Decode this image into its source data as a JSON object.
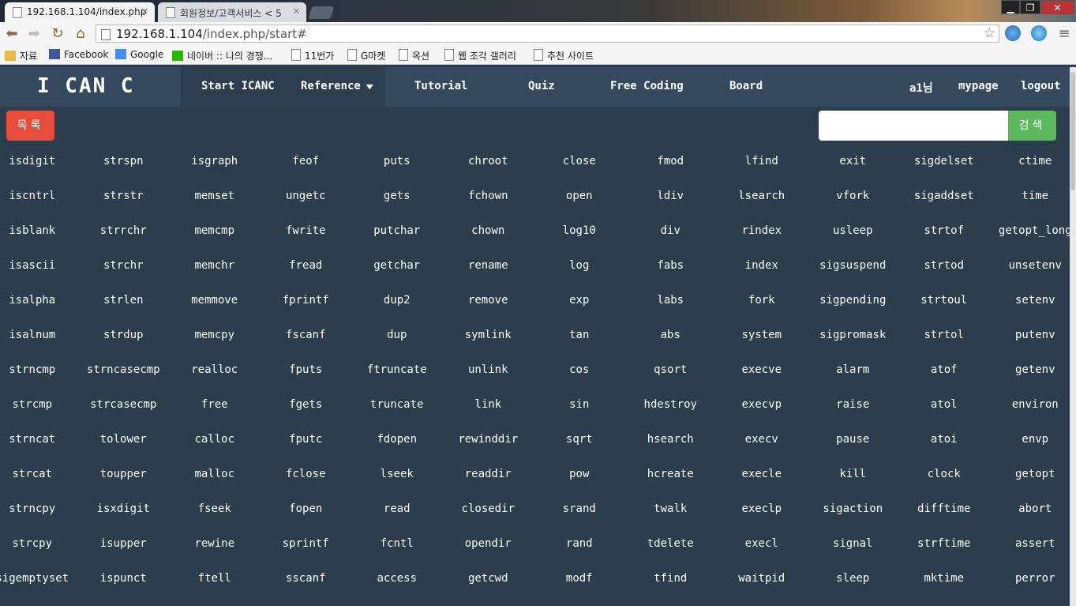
{
  "browser": {
    "tabs": [
      {
        "title": "192.168.1.104/index.php"
      },
      {
        "title": "회원정보/고객서비스 < 5"
      }
    ],
    "url_host": "192.168.1.104",
    "url_path": "/index.php/start#",
    "bookmarks": [
      "자료",
      "Facebook",
      "Google",
      "네이버 :: 나의 경쟁...",
      "11번가",
      "G마켓",
      "옥션",
      "웹 조각 갤러리",
      "추천 사이트"
    ],
    "window_buttons": {
      "min": "▁",
      "max": "❐",
      "close": "✕"
    }
  },
  "navbar": {
    "brand": "I CAN C",
    "items": {
      "start": "Start ICANC",
      "reference": "Reference",
      "tutorial": "Tutorial",
      "quiz": "Quiz",
      "free_coding": "Free Coding",
      "board": "Board",
      "user": "a1님",
      "mypage": "mypage",
      "logout": "logout"
    }
  },
  "controls": {
    "list_button": "목록",
    "search_button": "검색",
    "search_value": ""
  },
  "functions": [
    "isdigit",
    "strspn",
    "isgraph",
    "feof",
    "puts",
    "chroot",
    "close",
    "fmod",
    "lfind",
    "exit",
    "sigdelset",
    "ctime",
    "iscntrl",
    "strstr",
    "memset",
    "ungetc",
    "gets",
    "fchown",
    "open",
    "ldiv",
    "lsearch",
    "vfork",
    "sigaddset",
    "time",
    "isblank",
    "strrchr",
    "memcmp",
    "fwrite",
    "putchar",
    "chown",
    "log10",
    "div",
    "rindex",
    "usleep",
    "strtof",
    "getopt_long",
    "isascii",
    "strchr",
    "memchr",
    "fread",
    "getchar",
    "rename",
    "log",
    "fabs",
    "index",
    "sigsuspend",
    "strtod",
    "unsetenv",
    "isalpha",
    "strlen",
    "memmove",
    "fprintf",
    "dup2",
    "remove",
    "exp",
    "labs",
    "fork",
    "sigpending",
    "strtoul",
    "setenv",
    "isalnum",
    "strdup",
    "memcpy",
    "fscanf",
    "dup",
    "symlink",
    "tan",
    "abs",
    "system",
    "sigpromask",
    "strtol",
    "putenv",
    "strncmp",
    "strncasecmp",
    "realloc",
    "fputs",
    "ftruncate",
    "unlink",
    "cos",
    "qsort",
    "execve",
    "alarm",
    "atof",
    "getenv",
    "strcmp",
    "strcasecmp",
    "free",
    "fgets",
    "truncate",
    "link",
    "sin",
    "hdestroy",
    "execvp",
    "raise",
    "atol",
    "environ",
    "strncat",
    "tolower",
    "calloc",
    "fputc",
    "fdopen",
    "rewinddir",
    "sqrt",
    "hsearch",
    "execv",
    "pause",
    "atoi",
    "envp",
    "strcat",
    "toupper",
    "malloc",
    "fclose",
    "lseek",
    "readdir",
    "pow",
    "hcreate",
    "execle",
    "kill",
    "clock",
    "getopt",
    "strncpy",
    "isxdigit",
    "fseek",
    "fopen",
    "read",
    "closedir",
    "srand",
    "twalk",
    "execlp",
    "sigaction",
    "difftime",
    "abort",
    "strcpy",
    "isupper",
    "rewine",
    "sprintf",
    "fcntl",
    "opendir",
    "rand",
    "tdelete",
    "execl",
    "signal",
    "strftime",
    "assert",
    "sigemptyset",
    "ispunct",
    "ftell",
    "sscanf",
    "access",
    "getcwd",
    "modf",
    "tfind",
    "waitpid",
    "sleep",
    "mktime",
    "perror"
  ]
}
